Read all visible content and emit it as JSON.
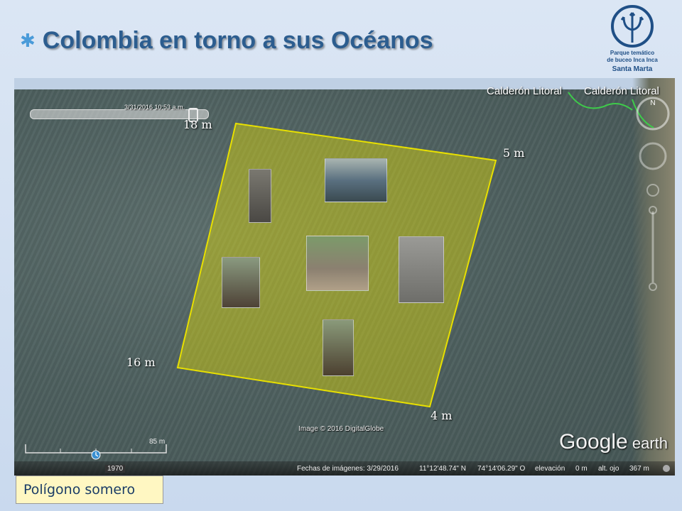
{
  "slide": {
    "title": "Colombia en torno a sus Océanos",
    "caption": "Polígono somero"
  },
  "logo": {
    "line1": "Parque temático",
    "line2": "de buceo Inca Inca",
    "line3": "Santa Marta",
    "color": "#1f4f86"
  },
  "map": {
    "place_label": "Calderón Litoral",
    "place_label_2": "Calderón Litoral",
    "polygon_color": "#e8e000",
    "slider_date": "3/31/2016  10:53 a.m.",
    "image_credit": "Image © 2016 DigitalGlobe",
    "brand": "Google",
    "brand_suffix": "earth",
    "scale_label": "85 m",
    "year_label": "1970",
    "depths": {
      "top_left": "18 m",
      "top_right": "5 m",
      "bottom_left": "16 m",
      "bottom_right": "4 m"
    },
    "status": {
      "imagery_date": "Fechas de imágenes: 3/29/2016",
      "lat": "11°12'48.74\" N",
      "lon": "74°14'06.29\" O",
      "elevation_label": "elevación",
      "elevation": "0 m",
      "eye_label": "alt. ojo",
      "eye_alt": "367 m"
    }
  }
}
